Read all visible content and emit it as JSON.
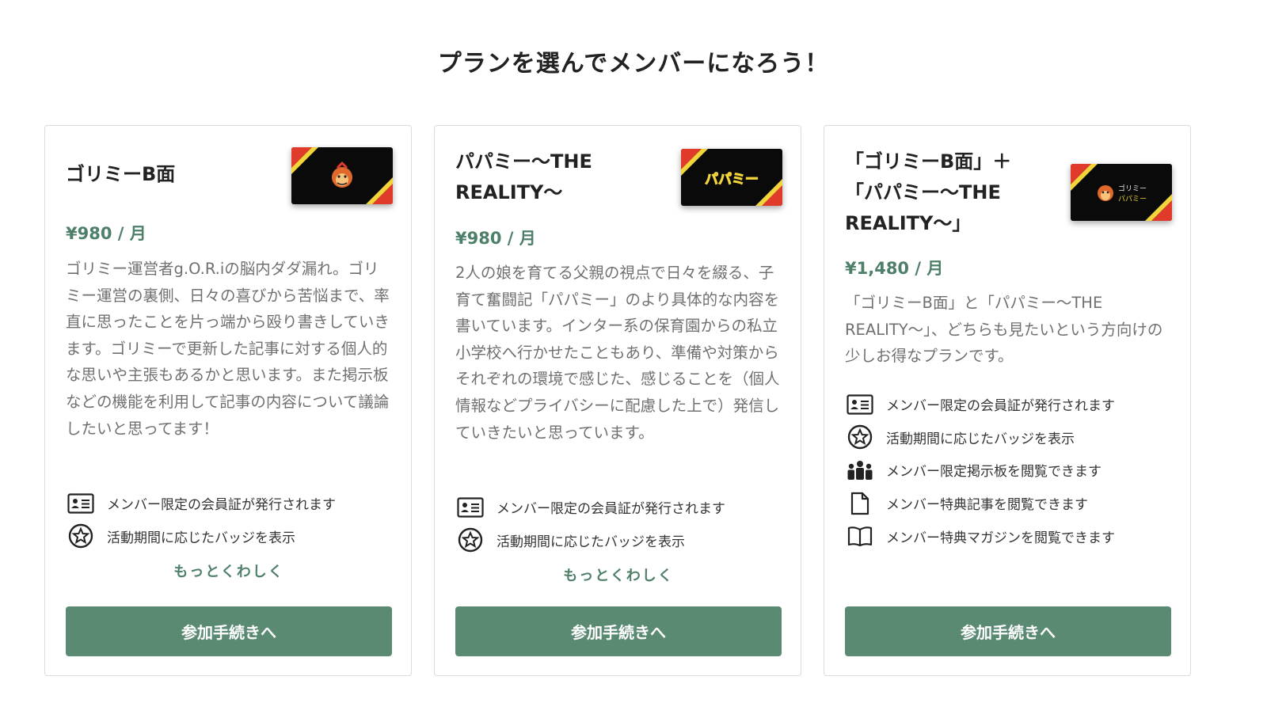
{
  "page": {
    "title": "プランを選んでメンバーになろう！"
  },
  "colors": {
    "accent": "#4e8069",
    "button": "#5a8a72",
    "thumb_stripe_red": "#e03a2a",
    "thumb_stripe_yellow": "#f2d43b"
  },
  "plans": [
    {
      "name": "ゴリミーB面",
      "thumb_icon": "monkey-face-icon",
      "price": "¥980 / 月",
      "description": "ゴリミー運営者g.O.R.iの脳内ダダ漏れ。ゴリミー運営の裏側、日々の喜びから苦悩まで、率直に思ったことを片っ端から殴り書きしていきます。ゴリミーで更新した記事に対する個人的な思いや主張もあるかと思います。また掲示板などの機能を利用して記事の内容について議論したいと思ってます！",
      "benefits": [
        {
          "icon": "id-card-icon",
          "label": "メンバー限定の会員証が発行されます"
        },
        {
          "icon": "star-badge-icon",
          "label": "活動期間に応じたバッジを表示"
        }
      ],
      "more_label": "もっとくわしく",
      "button_label": "参加手続きへ"
    },
    {
      "name": "パパミー〜THE REALITY〜",
      "thumb_text": "パパミー",
      "price": "¥980 / 月",
      "description": "2人の娘を育てる父親の視点で日々を綴る、子育て奮闘記「パパミー」のより具体的な内容を書いています。インター系の保育園からの私立小学校へ行かせたこともあり、準備や対策からそれぞれの環境で感じた、感じることを（個人情報などプライバシーに配慮した上で）発信していきたいと思っています。",
      "benefits": [
        {
          "icon": "id-card-icon",
          "label": "メンバー限定の会員証が発行されます"
        },
        {
          "icon": "star-badge-icon",
          "label": "活動期間に応じたバッジを表示"
        }
      ],
      "more_label": "もっとくわしく",
      "button_label": "参加手続きへ"
    },
    {
      "name": "「ゴリミーB面」＋「パパミー〜THE REALITY〜」",
      "thumb_icon": "monkey-face-icon",
      "thumb_text_1": "ゴリミー",
      "thumb_text_2": "パパミー",
      "price": "¥1,480 / 月",
      "description": "「ゴリミーB面」と「パパミー〜THE REALITY〜」、どちらも見たいという方向けの少しお得なプランです。",
      "benefits": [
        {
          "icon": "id-card-icon",
          "label": "メンバー限定の会員証が発行されます"
        },
        {
          "icon": "star-badge-icon",
          "label": "活動期間に応じたバッジを表示"
        },
        {
          "icon": "group-icon",
          "label": "メンバー限定掲示板を閲覧できます"
        },
        {
          "icon": "document-icon",
          "label": "メンバー特典記事を閲覧できます"
        },
        {
          "icon": "book-icon",
          "label": "メンバー特典マガジンを閲覧できます"
        }
      ],
      "button_label": "参加手続きへ"
    }
  ]
}
